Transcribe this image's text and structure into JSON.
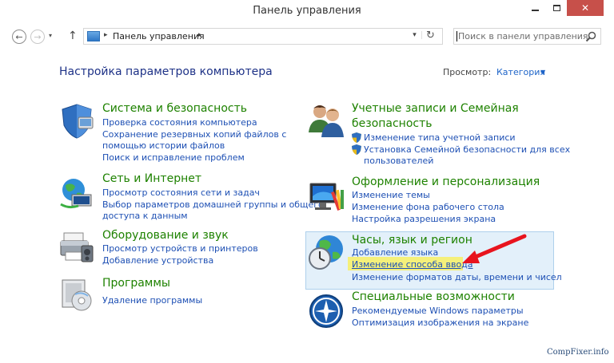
{
  "window": {
    "title": "Панель управления",
    "close_glyph": "✕"
  },
  "nav": {
    "back_glyph": "←",
    "forward_glyph": "→",
    "history_glyph": "▾",
    "up_glyph": "↑",
    "address_text": "Панель управления",
    "address_caret": "▸",
    "dropdown_glyph": "▾",
    "refresh_glyph": "↻",
    "search_placeholder": "Поиск в панели управления"
  },
  "header": {
    "title": "Настройка параметров компьютера",
    "view_label": "Просмотр:",
    "view_value": "Категория",
    "view_caret": "▼"
  },
  "categories": {
    "security": {
      "title": "Система и безопасность",
      "links": [
        "Проверка состояния компьютера",
        "Сохранение резервных копий файлов с",
        "помощью истории файлов",
        "Поиск и исправление проблем"
      ]
    },
    "network": {
      "title": "Сеть и Интернет",
      "links": [
        "Просмотр состояния сети и задач",
        "Выбор параметров домашней группы и общего",
        "доступа к данным"
      ]
    },
    "hardware": {
      "title": "Оборудование и звук",
      "links": [
        "Просмотр устройств и принтеров",
        "Добавление устройства"
      ]
    },
    "programs": {
      "title": "Программы",
      "links": [
        "Удаление программы"
      ]
    },
    "accounts": {
      "title_line1": "Учетные записи и Семейная",
      "title_line2": "безопасность",
      "links": [
        "Изменение типа учетной записи",
        "Установка Семейной безопасности для всех",
        "пользователей"
      ]
    },
    "appearance": {
      "title": "Оформление и персонализация",
      "links": [
        "Изменение темы",
        "Изменение фона рабочего стола",
        "Настройка разрешения экрана"
      ]
    },
    "clock": {
      "title": "Часы, язык и регион",
      "links": [
        "Добавление языка",
        "Изменение способа ввода",
        "Изменение форматов даты, времени и чисел"
      ]
    },
    "access": {
      "title": "Специальные возможности",
      "links": [
        "Рекомендуемые Windows параметры",
        "Оптимизация изображения на экране"
      ]
    }
  },
  "colors": {
    "category_title": "#1e8200",
    "link": "#1e50b4",
    "highlight": "#f5f07a",
    "arrow": "#e8141e"
  },
  "watermark": "CompFixer.info"
}
